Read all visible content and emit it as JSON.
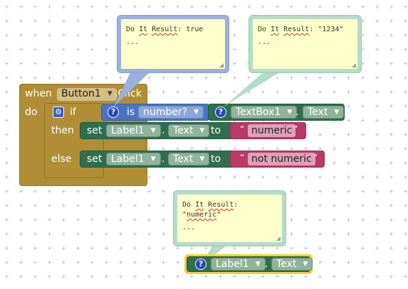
{
  "event": {
    "when": "when",
    "component": "Button1",
    "event_name": ".Click",
    "do": "do"
  },
  "if_block": {
    "if": "if",
    "then": "then",
    "else": "else"
  },
  "condition": {
    "is": "is",
    "type": "number?",
    "component": "TextBox1",
    "dot": ".",
    "property": "Text"
  },
  "set_then": {
    "set": "set",
    "component": "Label1",
    "dot": ".",
    "property": "Text",
    "to": "to",
    "value": "numeric"
  },
  "set_else": {
    "set": "set",
    "component": "Label1",
    "dot": ".",
    "property": "Text",
    "to": "to",
    "value": "not numeric"
  },
  "getter": {
    "component": "Label1",
    "dot": ".",
    "property": "Text"
  },
  "comments": {
    "left": {
      "do": "Do",
      "it": "It",
      "result": "Result",
      "value": ": true",
      "body": "---"
    },
    "right": {
      "do": "Do",
      "it": "It",
      "result": "Result",
      "value": ": \"1234\"",
      "body": "---"
    },
    "bottom": {
      "do": "Do",
      "it": "It",
      "result": "Result",
      "value_pre": ": \"",
      "value_word": "numeric",
      "value_post": "\"",
      "body": "---"
    }
  },
  "quote_open": "“",
  "quote_close": "”",
  "icons": {
    "help": "question-mark-icon",
    "mutator": "gear-icon",
    "dropdown": "triangle-down"
  },
  "colors": {
    "event": "#b18e35",
    "component_block": "#2f6f4f",
    "logic_block": "#4a73c3",
    "text_block": "#b83a67",
    "comment_bg": "#ffffcb",
    "selection": "#f2d234"
  }
}
